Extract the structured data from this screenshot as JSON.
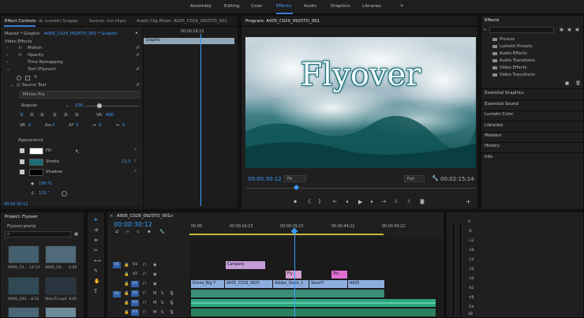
{
  "workspaces": {
    "items": [
      "Assembly",
      "Editing",
      "Color",
      "Effects",
      "Audio",
      "Graphics",
      "Libraries"
    ],
    "active_index": 3,
    "more": "»"
  },
  "effect_controls": {
    "tabs": [
      "Effect Controls",
      "Lumetri Scopes",
      "Source: (no clips)",
      "Audio Clip Mixer: A005_C029_0925TO_001"
    ],
    "tab_menu": "≡",
    "master_label": "Master * Graphic",
    "sequence_label": "A005_C029_0925TO_001 * Graphic",
    "mini_timecode": "00:00:29:23",
    "graphic_clip": "Graphic",
    "video_effects": "Video Effects",
    "motion": "Motion",
    "opacity": "Opacity",
    "time_remapping": "Time Remapping",
    "text_layer": "Text (Flyover)",
    "source_text": "Source Text",
    "font": "Minion Pro",
    "font_style": "Regular",
    "font_size": "100",
    "tracking": "400",
    "zeros": [
      "0",
      "0",
      "0",
      "0",
      "0",
      "0"
    ],
    "appearance": "Appearance",
    "fill": "Fill",
    "stroke": "Stroke",
    "stroke_width": "11.0",
    "shadow": "Shadow",
    "opacity_val": "100 %",
    "angle_val": "122 °",
    "timecode": "00:00:30:12",
    "fill_color": "#ffffff",
    "stroke_color": "#1a6f78",
    "shadow_color": "#000000"
  },
  "program": {
    "title": "Program: A005_C029_0925TO_001",
    "overlay_text": "Flyover",
    "timecode": "00:00:30:12",
    "fit": "Fit",
    "quality": "Full",
    "duration": "00:02:15:14"
  },
  "effects_panel": {
    "title": "Effects",
    "folders": [
      "Presets",
      "Lumetri Presets",
      "Audio Effects",
      "Audio Transitions",
      "Video Effects",
      "Video Transitions"
    ],
    "sections": [
      "Essential Graphics",
      "Essential Sound",
      "Lumetri Color",
      "Libraries",
      "Markers",
      "History",
      "Info"
    ]
  },
  "project": {
    "title": "Project: Flyover",
    "file": "Flyover.prproj",
    "items": [
      {
        "name": "A005_C0...",
        "dur": "12:14"
      },
      {
        "name": "A005_C0...",
        "dur": "2:04"
      },
      {
        "name": "A005_C02...",
        "dur": "4:12"
      },
      {
        "name": "StarsTi.mp4",
        "dur": "4:01"
      }
    ]
  },
  "timeline": {
    "tab": "A005_C029_0925TO_001",
    "timecode": "00:00:30:12",
    "ruler": [
      "00:00",
      "00:00:14:23",
      "00:00:29:23",
      "00:00:44:22",
      "00:00:59:22"
    ],
    "tracks": {
      "video": [
        "V3",
        "V2",
        "V1"
      ],
      "audio": [
        "A1",
        "A2",
        "A3"
      ],
      "source": [
        "V1",
        "A1"
      ]
    },
    "clips": {
      "v3": "Carspero",
      "v2a": "Fly",
      "v2b": "Tro",
      "v1": [
        "Drone_Big Y",
        "A005_C029_0925",
        "Adobe_Stock_1",
        "StarsTi",
        "A005"
      ]
    },
    "track_controls": {
      "mute": "M",
      "solo": "S"
    }
  },
  "meter_scale": [
    "0",
    "-6",
    "-12",
    "-18",
    "-24",
    "-30",
    "-36",
    "-42",
    "-48",
    "-54",
    "dB"
  ]
}
